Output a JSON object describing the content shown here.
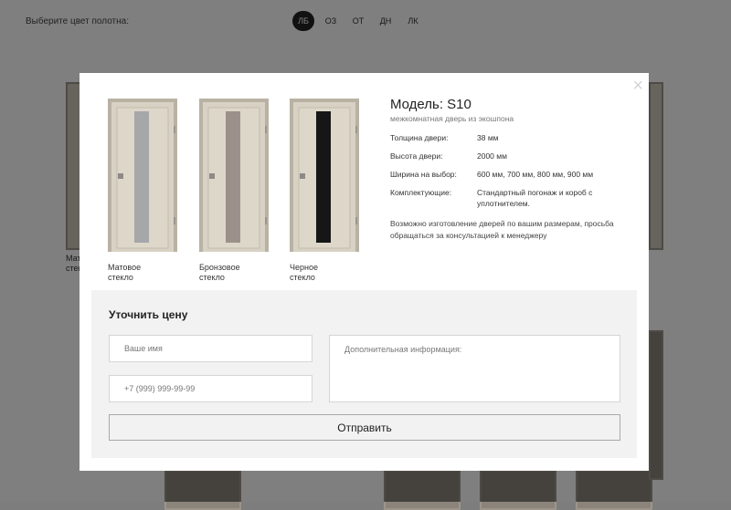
{
  "background": {
    "color_label": "Выберите цвет полотна:",
    "color_tabs": [
      {
        "label": "ЛБ",
        "active": true
      },
      {
        "label": "ОЗ",
        "active": false
      },
      {
        "label": "ОТ",
        "active": false
      },
      {
        "label": "ДН",
        "active": false
      },
      {
        "label": "ЛК",
        "active": false
      }
    ],
    "caption_fragment_1": "Мат",
    "caption_fragment_2": "стек"
  },
  "modal": {
    "close_icon": "×",
    "doors": [
      {
        "caption_line1": "Матовое",
        "caption_line2": "стекло",
        "glass": "matte"
      },
      {
        "caption_line1": "Бронзовое",
        "caption_line2": "стекло",
        "glass": "bronze"
      },
      {
        "caption_line1": "Черное",
        "caption_line2": "стекло",
        "glass": "black"
      }
    ],
    "model_title": "Модель: S10",
    "model_subtitle": "межкомнатная дверь из экошпона",
    "specs": [
      {
        "label": "Толщина двери:",
        "value": "38 мм"
      },
      {
        "label": "Высота двери:",
        "value": "2000 мм"
      },
      {
        "label": "Ширина на выбор:",
        "value": "600 мм, 700 мм, 800 мм, 900 мм"
      },
      {
        "label": "Комплектующие:",
        "value": "Стандартный погонаж и короб с уплотнителем."
      }
    ],
    "note": "Возможно изготовление дверей по вашим размерам, просьба обращаться за консультацией к менеджеру",
    "form": {
      "title": "Уточнить цену",
      "name_placeholder": "Ваше имя",
      "phone_placeholder": "+7 (999) 999-99-99",
      "extra_placeholder": "Дополнительная информация:",
      "submit_label": "Отправить"
    }
  },
  "colors": {
    "overlay": "#000000",
    "door_finish": "#d8d2c4",
    "glass_matte": "#a6a7a9",
    "glass_bronze": "#9c918a",
    "glass_black": "#161616"
  }
}
